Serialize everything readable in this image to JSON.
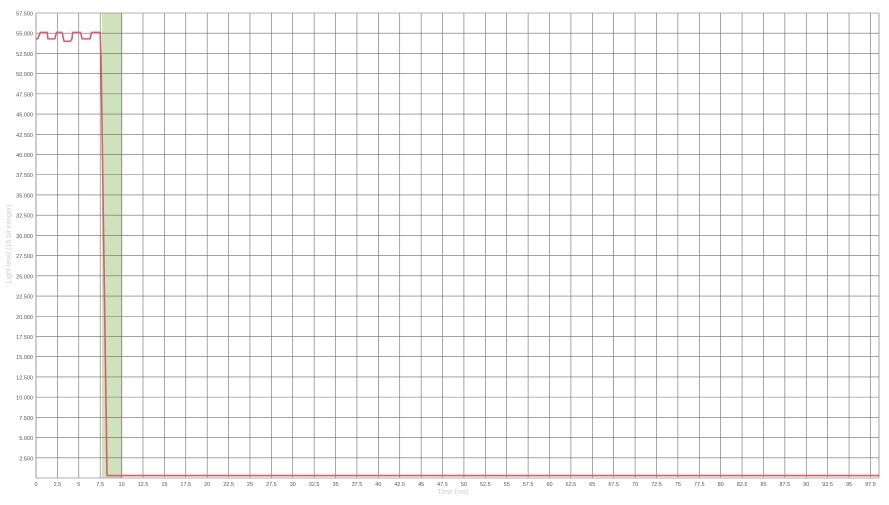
{
  "chart_data": {
    "type": "line",
    "title": "",
    "xlabel": "Time (ms)",
    "ylabel": "Light level (16 bit integer)",
    "xlim": [
      0,
      98.5
    ],
    "ylim": [
      0,
      57500
    ],
    "grid": true,
    "x_ticks": [
      0,
      2.5,
      5,
      7.5,
      10,
      12.5,
      15,
      17.5,
      20,
      22.5,
      25,
      27.5,
      30,
      32.5,
      35,
      37.5,
      40,
      42.5,
      45,
      47.5,
      50,
      52.5,
      55,
      57.5,
      60,
      62.5,
      65,
      67.5,
      70,
      72.5,
      75,
      77.5,
      80,
      82.5,
      85,
      87.5,
      90,
      92.5,
      95,
      97.5
    ],
    "y_ticks": [
      2500,
      5000,
      7500,
      10000,
      12500,
      15000,
      17500,
      20000,
      22500,
      25000,
      27500,
      30000,
      32500,
      35000,
      37500,
      40000,
      42500,
      45000,
      47500,
      50000,
      52500,
      55000,
      57500
    ],
    "y_tick_labels": [
      "2.500",
      "5.000",
      "7.500",
      "10.000",
      "12.500",
      "15.000",
      "17.500",
      "20.000",
      "22.500",
      "25.000",
      "27.500",
      "30.000",
      "32.500",
      "35.000",
      "37.500",
      "40.000",
      "42.500",
      "45.000",
      "47.500",
      "50.000",
      "52.500",
      "55.000",
      "57.500"
    ],
    "highlight": {
      "x_start": 7.7,
      "x_end": 10.1,
      "color": "#c5ddb0"
    },
    "colors": {
      "line": "#e05a6a",
      "grid": "#6d6d6d",
      "axis": "#999999"
    },
    "series": [
      {
        "values": [
          [
            0,
            54300
          ],
          [
            0.2,
            54300
          ],
          [
            0.5,
            55100
          ],
          [
            1.3,
            55100
          ],
          [
            1.4,
            54300
          ],
          [
            2.2,
            54300
          ],
          [
            2.4,
            55100
          ],
          [
            3.0,
            55100
          ],
          [
            3.1,
            54900
          ],
          [
            3.2,
            54300
          ],
          [
            3.3,
            54000
          ],
          [
            4.0,
            54000
          ],
          [
            4.2,
            54300
          ],
          [
            4.3,
            55100
          ],
          [
            5.2,
            55100
          ],
          [
            5.4,
            54300
          ],
          [
            6.3,
            54300
          ],
          [
            6.5,
            55100
          ],
          [
            7.5,
            55100
          ],
          [
            7.6,
            52000
          ],
          [
            8.3,
            300
          ],
          [
            98.5,
            300
          ]
        ]
      }
    ]
  }
}
